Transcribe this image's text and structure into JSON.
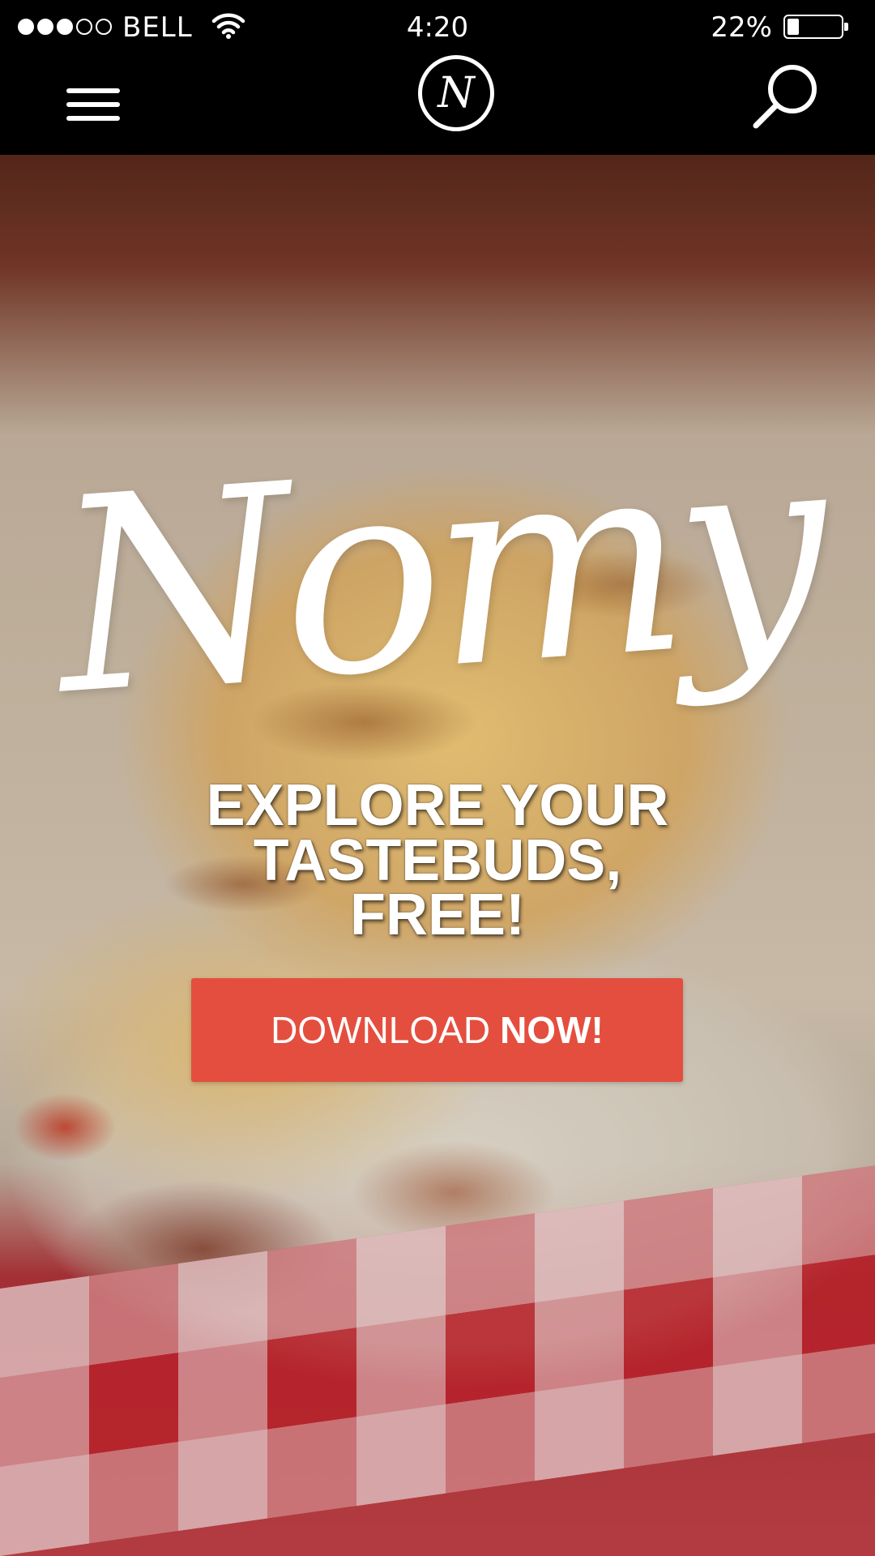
{
  "status_bar": {
    "signal_bars_filled": 3,
    "signal_bars_total": 5,
    "carrier": "BELL",
    "time": "4:20",
    "battery_percent_text": "22%",
    "battery_level": 0.22
  },
  "nav": {
    "menu_icon": "hamburger-menu-icon",
    "logo_letter": "N",
    "search_icon": "search-icon"
  },
  "hero": {
    "brand_name": "Nomy",
    "tagline_lines": [
      "EXPLORE YOUR",
      "TASTEBUDS,",
      "FREE!"
    ],
    "cta_label_regular": "DOWNLOAD",
    "cta_label_bold": "NOW!"
  },
  "colors": {
    "background": "#000000",
    "cta": "#e44e3e",
    "text": "#ffffff"
  }
}
